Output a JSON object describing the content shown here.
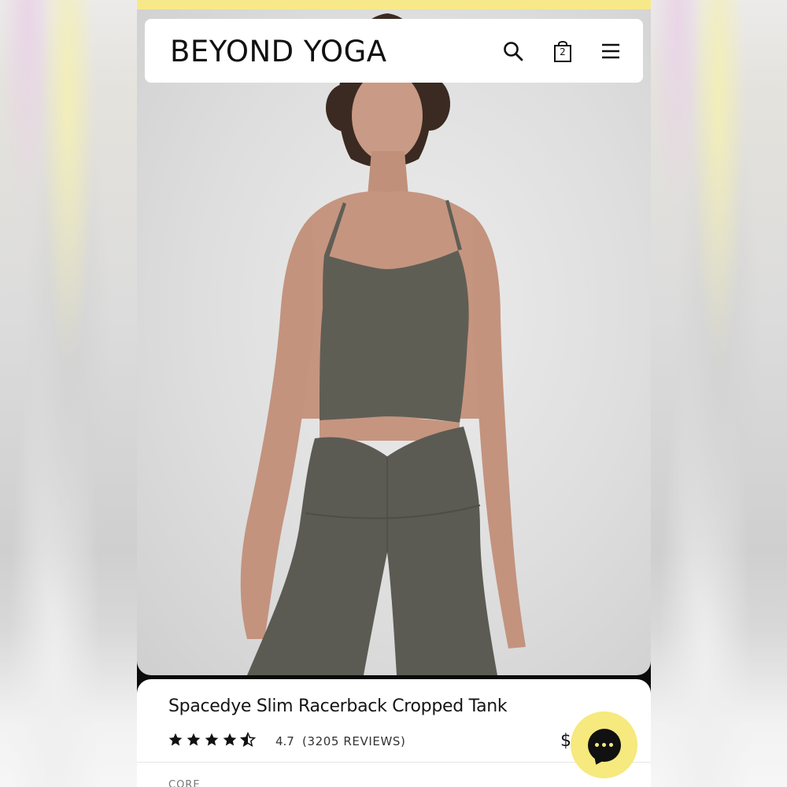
{
  "header": {
    "logo": "BEYOND YOGA",
    "search_icon": "search-icon",
    "bag_icon": "shopping-bag-icon",
    "bag_count": "2",
    "menu_icon": "hamburger-menu-icon"
  },
  "hero": {
    "image": "model wearing dark olive spacedye cropped tank and leggings"
  },
  "product": {
    "title": "Spacedye Slim Racerback Cropped Tank",
    "rating_value": 4.7,
    "rating_text": "4.7",
    "reviews_text": "(3205 REVIEWS)",
    "price_visible": "$",
    "collection_label": "CORE"
  },
  "chat": {
    "icon": "chat-bubble-icon"
  },
  "colors": {
    "promo_bar": "#f7e98a",
    "chat_button": "#f6e97d",
    "garment": "#5f5e55",
    "text": "#151515"
  }
}
